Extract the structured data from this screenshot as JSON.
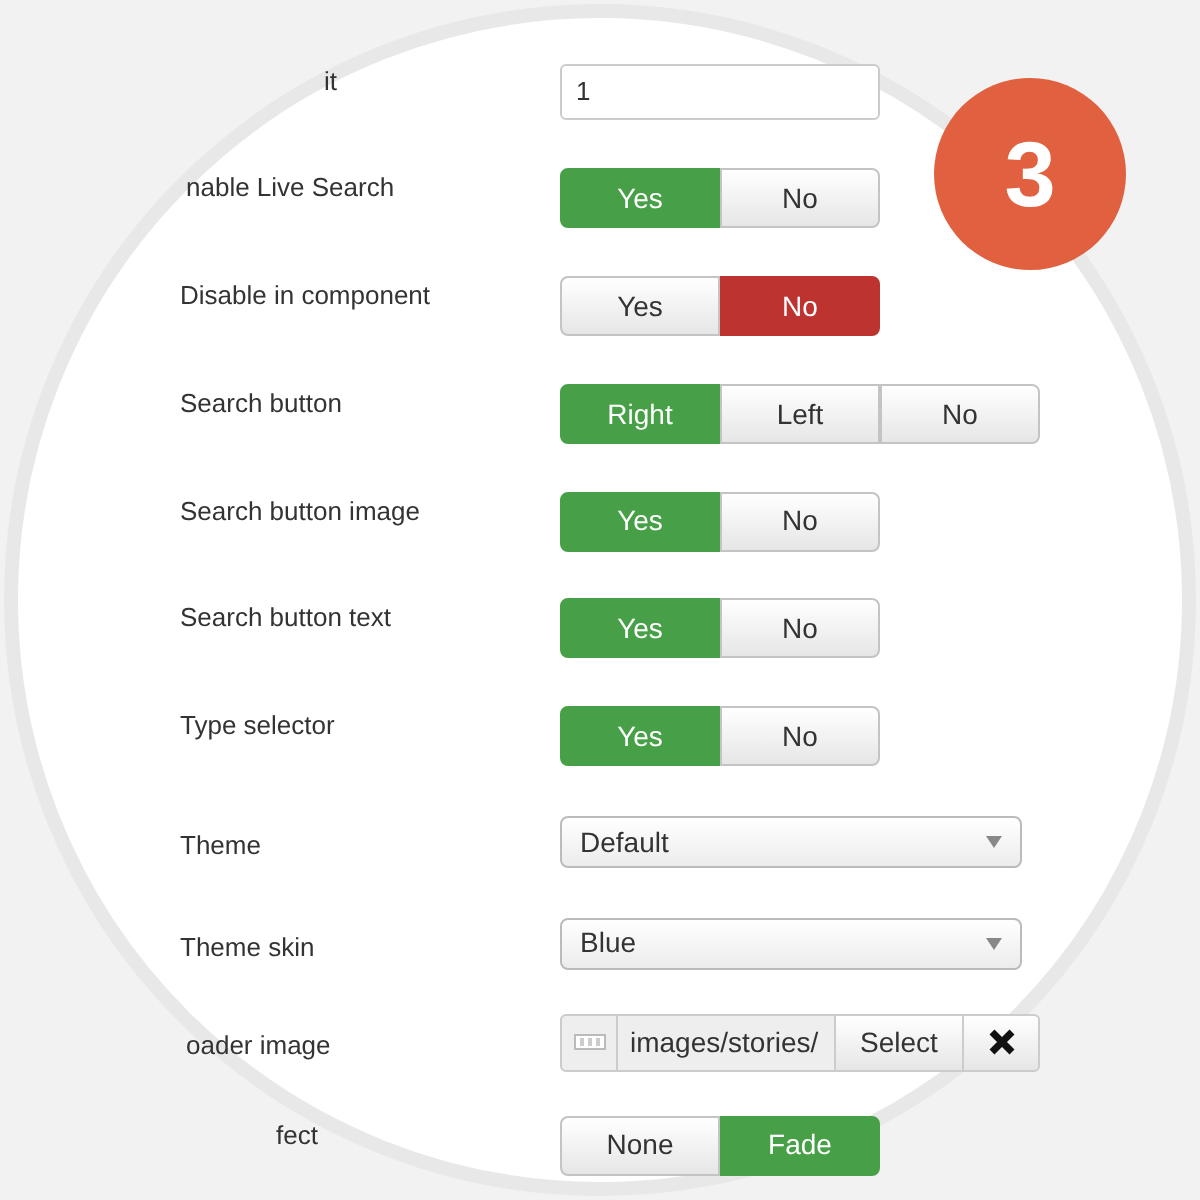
{
  "badge": "3",
  "fields": [
    {
      "kind": "text",
      "label": "it",
      "value": "1"
    },
    {
      "kind": "toggle",
      "label": "nable Live Search",
      "color": "#47a047",
      "options": [
        {
          "label": "Yes",
          "selected": true
        },
        {
          "label": "No",
          "selected": false
        }
      ]
    },
    {
      "kind": "toggle",
      "label": "Disable in component",
      "color": "#bd3330",
      "options": [
        {
          "label": "Yes",
          "selected": false
        },
        {
          "label": "No",
          "selected": true
        }
      ]
    },
    {
      "kind": "toggle",
      "label": "Search button",
      "color": "#47a047",
      "options": [
        {
          "label": "Right",
          "selected": true
        },
        {
          "label": "Left",
          "selected": false
        },
        {
          "label": "No",
          "selected": false
        }
      ]
    },
    {
      "kind": "toggle",
      "label": "Search button image",
      "color": "#47a047",
      "options": [
        {
          "label": "Yes",
          "selected": true
        },
        {
          "label": "No",
          "selected": false
        }
      ]
    },
    {
      "kind": "toggle",
      "label": "Search button text",
      "color": "#47a047",
      "options": [
        {
          "label": "Yes",
          "selected": true
        },
        {
          "label": "No",
          "selected": false
        }
      ]
    },
    {
      "kind": "toggle",
      "label": "Type selector",
      "color": "#47a047",
      "options": [
        {
          "label": "Yes",
          "selected": true
        },
        {
          "label": "No",
          "selected": false
        }
      ]
    },
    {
      "kind": "select",
      "label": "Theme",
      "value": "Default"
    },
    {
      "kind": "select",
      "label": "Theme skin",
      "value": "Blue"
    },
    {
      "kind": "media",
      "label": "oader image",
      "value": "images/stories/",
      "button": "Select"
    },
    {
      "kind": "toggle",
      "label": "fect",
      "color": "#47a047",
      "options": [
        {
          "label": "None",
          "selected": false
        },
        {
          "label": "Fade",
          "selected": true
        }
      ]
    }
  ]
}
